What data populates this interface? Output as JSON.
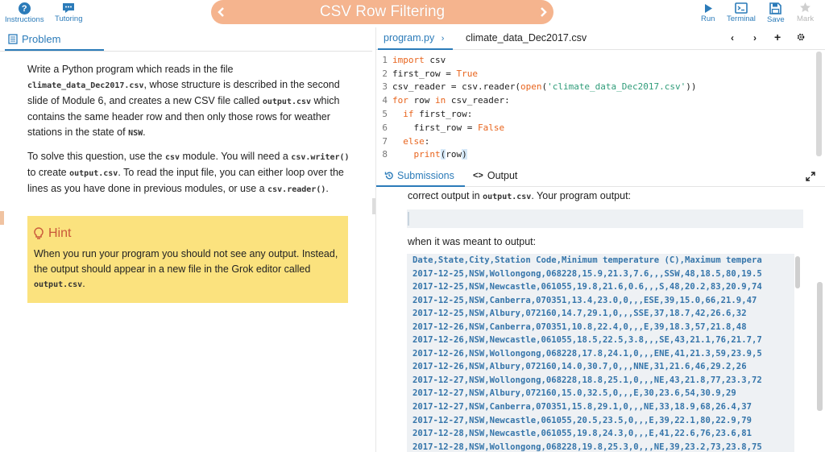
{
  "topbar": {
    "instructions_label": "Instructions",
    "tutoring_label": "Tutoring",
    "title": "CSV Row Filtering",
    "run_label": "Run",
    "terminal_label": "Terminal",
    "save_label": "Save",
    "mark_label": "Mark"
  },
  "left": {
    "tab_label": "Problem",
    "para1": [
      {
        "t": "Write a Python program which reads in the file "
      },
      {
        "c": "climate_data_Dec2017.csv"
      },
      {
        "t": ", whose structure is described in the second slide of Module 6, and creates a new CSV file called "
      },
      {
        "c": "output.csv"
      },
      {
        "t": " which contains the same header row and then only those rows for weather stations in the state of "
      },
      {
        "c": "NSW"
      },
      {
        "t": "."
      }
    ],
    "para2": [
      {
        "t": "To solve this question, use the "
      },
      {
        "c": "csv"
      },
      {
        "t": " module. You will need a "
      },
      {
        "c": "csv.writer()"
      },
      {
        "t": " to create "
      },
      {
        "c": "output.csv"
      },
      {
        "t": ". To read the input file, you can either loop over the lines as you have done in previous modules, or use a "
      },
      {
        "c": "csv.reader()"
      },
      {
        "t": "."
      }
    ],
    "hint_title": "Hint",
    "hint_body": [
      {
        "t": "When you run your program you should not see any output. Instead, the output should appear in a new file in the Grok editor called "
      },
      {
        "c": "output.csv"
      },
      {
        "t": "."
      }
    ]
  },
  "editor": {
    "tab1": "program.py",
    "tab2": "climate_data_Dec2017.csv",
    "lines": [
      [
        {
          "k": "import"
        },
        {
          "t": " csv"
        }
      ],
      [
        {
          "t": "first_row = "
        },
        {
          "k": "True"
        }
      ],
      [
        {
          "t": "csv_reader = csv.reader("
        },
        {
          "k": "open"
        },
        {
          "t": "("
        },
        {
          "s": "'climate_data_Dec2017.csv'"
        },
        {
          "t": "))"
        }
      ],
      [
        {
          "k": "for"
        },
        {
          "t": " row "
        },
        {
          "k": "in"
        },
        {
          "t": " csv_reader:"
        }
      ],
      [
        {
          "t": "  "
        },
        {
          "k": "if"
        },
        {
          "t": " first_row:"
        }
      ],
      [
        {
          "t": "    first_row = "
        },
        {
          "k": "False"
        }
      ],
      [
        {
          "t": "  "
        },
        {
          "k": "else"
        },
        {
          "t": ":"
        }
      ],
      [
        {
          "t": "    "
        },
        {
          "k": "print"
        },
        {
          "h": "("
        },
        {
          "t": "row"
        },
        {
          "h": ")"
        }
      ]
    ]
  },
  "output": {
    "tab1": "Submissions",
    "tab2": "Output",
    "line1_prefix": "correct output in ",
    "line1_code": "output.csv",
    "line1_suffix": ". Your program output:",
    "line2": "when it was meant to output:",
    "expected": [
      "Date,State,City,Station Code,Minimum temperature (C),Maximum tempera",
      "2017-12-25,NSW,Wollongong,068228,15.9,21.3,7.6,,,SSW,48,18.5,80,19.5",
      "2017-12-25,NSW,Newcastle,061055,19.8,21.6,0.6,,,S,48,20.2,83,20.9,74",
      "2017-12-25,NSW,Canberra,070351,13.4,23.0,0,,,ESE,39,15.0,66,21.9,47",
      "2017-12-25,NSW,Albury,072160,14.7,29.1,0,,,SSE,37,18.7,42,26.6,32",
      "2017-12-26,NSW,Canberra,070351,10.8,22.4,0,,,E,39,18.3,57,21.8,48",
      "2017-12-26,NSW,Newcastle,061055,18.5,22.5,3.8,,,SE,43,21.1,76,21.7,7",
      "2017-12-26,NSW,Wollongong,068228,17.8,24.1,0,,,ENE,41,21.3,59,23.9,5",
      "2017-12-26,NSW,Albury,072160,14.0,30.7,0,,,NNE,31,21.6,46,29.2,26",
      "2017-12-27,NSW,Wollongong,068228,18.8,25.1,0,,,NE,43,21.8,77,23.3,72",
      "2017-12-27,NSW,Albury,072160,15.0,32.5,0,,,E,30,23.6,54,30.9,29",
      "2017-12-27,NSW,Canberra,070351,15.8,29.1,0,,,NE,33,18.9,68,26.4,37",
      "2017-12-27,NSW,Newcastle,061055,20.5,23.5,0,,,E,39,22.1,80,22.9,79",
      "2017-12-28,NSW,Newcastle,061055,19.8,24.3,0,,,E,41,22.6,76,23.6,81",
      "2017-12-28,NSW,Wollongong,068228,19.8,25.3,0,,,NE,39,23.2,73,23.8,75"
    ]
  },
  "colors": {
    "accent": "#2b7bb9",
    "title_pill": "#f5b48e",
    "hint_bg": "#fbe27e",
    "keyword": "#e8641d",
    "string": "#2f9c79"
  },
  "icons": {
    "instructions": "question-circle-icon",
    "tutoring": "chat-icon",
    "run": "play-icon",
    "terminal": "terminal-icon",
    "save": "floppy-icon",
    "mark": "star-icon"
  }
}
